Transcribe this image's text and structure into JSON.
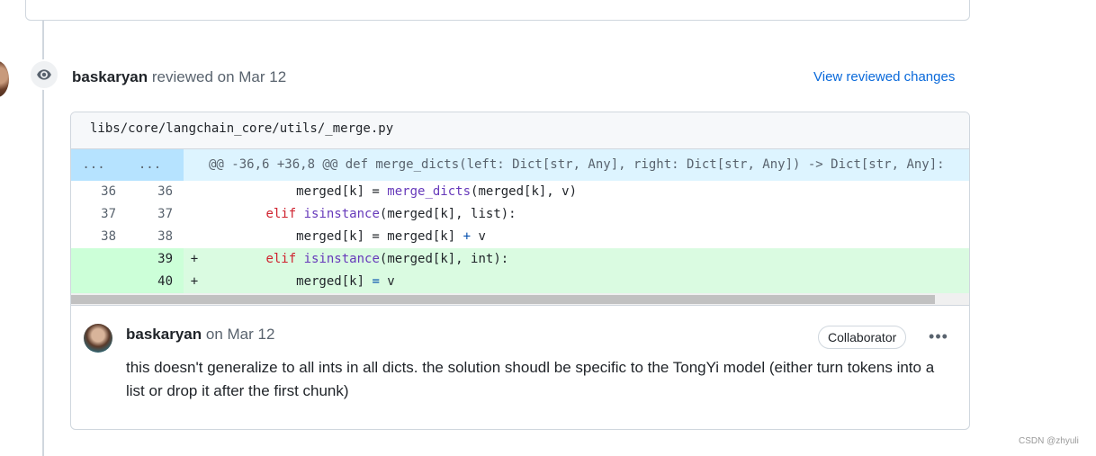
{
  "review": {
    "author": "baskaryan",
    "action": "reviewed on Mar 12",
    "view_link": "View reviewed changes"
  },
  "file": {
    "path": "libs/core/langchain_core/utils/_merge.py"
  },
  "diff": {
    "hunk": {
      "old_ln": "...",
      "new_ln": "...",
      "text": "@@ -36,6 +36,8 @@ def merge_dicts(left: Dict[str, Any], right: Dict[str, Any]) -> Dict[str, Any]:"
    },
    "lines": [
      {
        "old": "36",
        "new": "36",
        "marker": "",
        "pre": "            merged[k] = ",
        "fn": "merge_dicts",
        "post": "(merged[k], v)"
      },
      {
        "old": "37",
        "new": "37",
        "marker": "",
        "indent": "        ",
        "kw": "elif",
        "sp": " ",
        "fn": "isinstance",
        "post": "(merged[k], list):"
      },
      {
        "old": "38",
        "new": "38",
        "marker": "",
        "pre": "            merged[k] = merged[k] ",
        "op": "+",
        "post": " v"
      },
      {
        "old": "",
        "new": "39",
        "marker": "+",
        "indent": "        ",
        "kw": "elif",
        "sp": " ",
        "fn": "isinstance",
        "post": "(merged[k], int):"
      },
      {
        "old": "",
        "new": "40",
        "marker": "+",
        "pre": "            merged[k] ",
        "op": "=",
        "post": " v"
      }
    ]
  },
  "comment": {
    "author": "baskaryan",
    "date": "on Mar 12",
    "role": "Collaborator",
    "more": "•••",
    "body": "this doesn't generalize to all ints in all dicts. the solution shoudl be specific to the TongYi model (either turn tokens into a list or drop it after the first chunk)"
  },
  "watermark": "CSDN @zhyuli",
  "icons": {
    "review_icon": "eye-icon",
    "more_icon": "kebab-horizontal-icon"
  }
}
